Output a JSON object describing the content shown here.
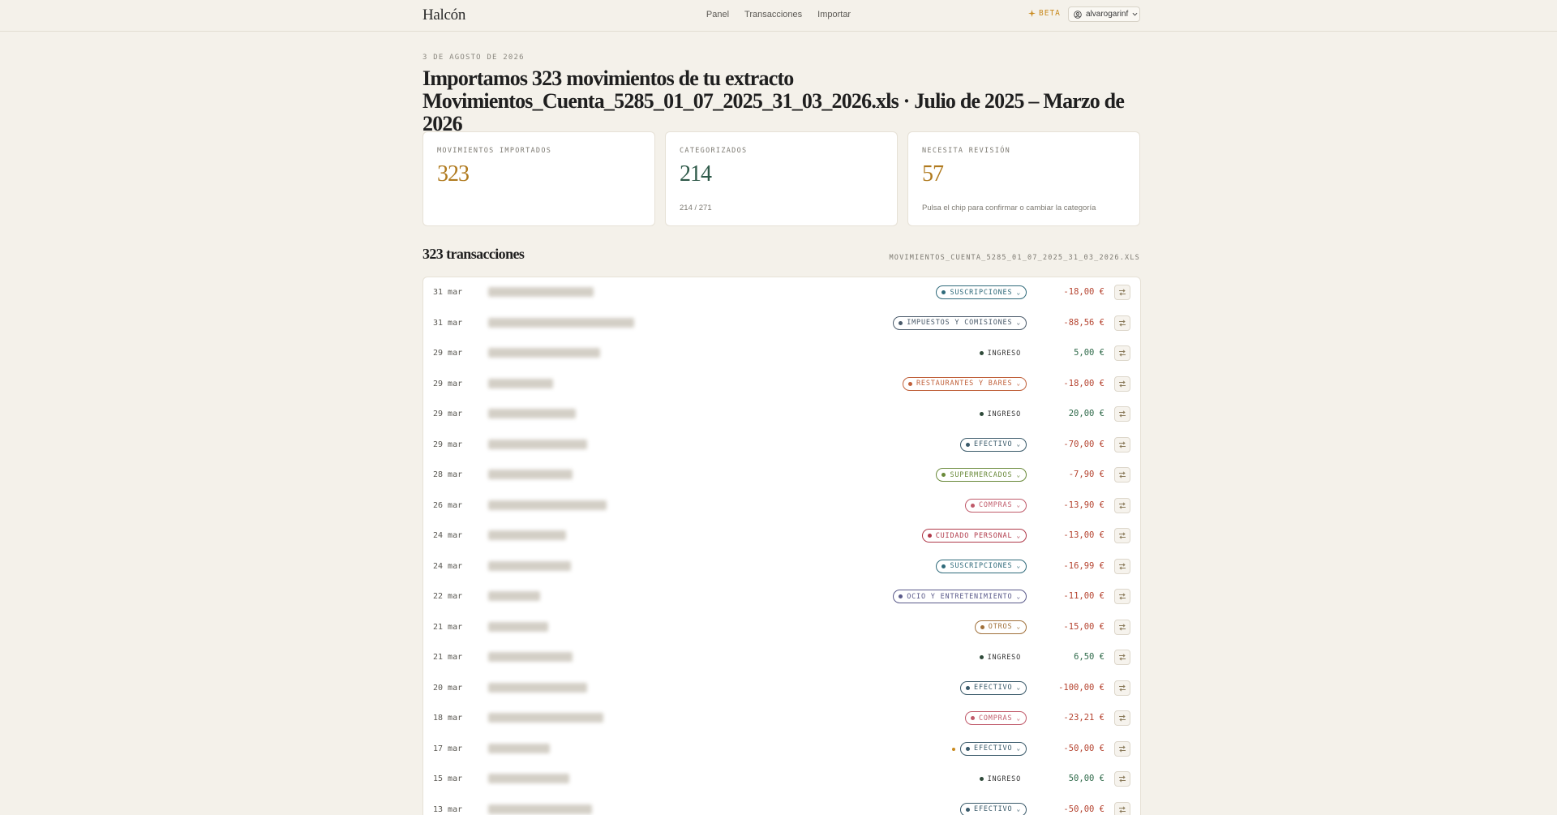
{
  "header": {
    "brand": "Halcón",
    "nav": [
      "Panel",
      "Transacciones",
      "Importar"
    ],
    "beta": "BETA",
    "user": "alvarogarinf"
  },
  "page": {
    "date": "3 DE AGOSTO DE 2026",
    "headline": "Importamos 323 movimientos de tu extracto Movimientos_Cuenta_5285_01_07_2025_31_03_2026.xls · Julio de 2025 – Marzo de 2026"
  },
  "stats": [
    {
      "label": "MOVIMIENTOS IMPORTADOS",
      "value": "323",
      "sub": "",
      "color": "#b07a1e"
    },
    {
      "label": "CATEGORIZADOS",
      "value": "214",
      "sub": "214 / 271",
      "color": "#2f5a4a"
    },
    {
      "label": "NECESITA REVISIÓN",
      "value": "57",
      "sub": "Pulsa el chip para confirmar o cambiar la categoría",
      "color": "#b07a1e"
    }
  ],
  "list": {
    "title": "323 transacciones",
    "file": "MOVIMIENTOS_CUENTA_5285_01_07_2025_31_03_2026.XLS"
  },
  "transactions": [
    {
      "date": "31 mar",
      "category": "SUSCRIPCIONES",
      "color": "#2f6a7a",
      "amount": "-18,00 €",
      "sign": "neg",
      "editable": true,
      "flag": false
    },
    {
      "date": "31 mar",
      "category": "IMPUESTOS Y COMISIONES",
      "color": "#4a5a6a",
      "amount": "-88,56 €",
      "sign": "neg",
      "editable": true,
      "flag": false
    },
    {
      "date": "29 mar",
      "category": "INGRESO",
      "color": "#2f4a3a",
      "amount": "5,00 €",
      "sign": "pos",
      "editable": false,
      "flag": false
    },
    {
      "date": "29 mar",
      "category": "RESTAURANTES Y BARES",
      "color": "#c0603a",
      "amount": "-18,00 €",
      "sign": "neg",
      "editable": true,
      "flag": false
    },
    {
      "date": "29 mar",
      "category": "INGRESO",
      "color": "#2f4a3a",
      "amount": "20,00 €",
      "sign": "pos",
      "editable": false,
      "flag": false
    },
    {
      "date": "29 mar",
      "category": "EFECTIVO",
      "color": "#3a5a6a",
      "amount": "-70,00 €",
      "sign": "neg",
      "editable": true,
      "flag": false
    },
    {
      "date": "28 mar",
      "category": "SUPERMERCADOS",
      "color": "#6a8a3a",
      "amount": "-7,90 €",
      "sign": "neg",
      "editable": true,
      "flag": false
    },
    {
      "date": "26 mar",
      "category": "COMPRAS",
      "color": "#c05a6a",
      "amount": "-13,90 €",
      "sign": "neg",
      "editable": true,
      "flag": false
    },
    {
      "date": "24 mar",
      "category": "CUIDADO PERSONAL",
      "color": "#b03a4a",
      "amount": "-13,00 €",
      "sign": "neg",
      "editable": true,
      "flag": false
    },
    {
      "date": "24 mar",
      "category": "SUSCRIPCIONES",
      "color": "#2f6a7a",
      "amount": "-16,99 €",
      "sign": "neg",
      "editable": true,
      "flag": false
    },
    {
      "date": "22 mar",
      "category": "OCIO Y ENTRETENIMIENTO",
      "color": "#5a5a8a",
      "amount": "-11,00 €",
      "sign": "neg",
      "editable": true,
      "flag": false
    },
    {
      "date": "21 mar",
      "category": "OTROS",
      "color": "#a0703a",
      "amount": "-15,00 €",
      "sign": "neg",
      "editable": true,
      "flag": false
    },
    {
      "date": "21 mar",
      "category": "INGRESO",
      "color": "#2f4a3a",
      "amount": "6,50 €",
      "sign": "pos",
      "editable": false,
      "flag": false
    },
    {
      "date": "20 mar",
      "category": "EFECTIVO",
      "color": "#3a5a6a",
      "amount": "-100,00 €",
      "sign": "neg",
      "editable": true,
      "flag": false
    },
    {
      "date": "18 mar",
      "category": "COMPRAS",
      "color": "#c05a6a",
      "amount": "-23,21 €",
      "sign": "neg",
      "editable": true,
      "flag": false
    },
    {
      "date": "17 mar",
      "category": "EFECTIVO",
      "color": "#3a5a6a",
      "amount": "-50,00 €",
      "sign": "neg",
      "editable": true,
      "flag": true
    },
    {
      "date": "15 mar",
      "category": "INGRESO",
      "color": "#2f4a3a",
      "amount": "50,00 €",
      "sign": "pos",
      "editable": false,
      "flag": false
    },
    {
      "date": "13 mar",
      "category": "EFECTIVO",
      "color": "#3a5a6a",
      "amount": "-50,00 €",
      "sign": "neg",
      "editable": true,
      "flag": false
    }
  ]
}
